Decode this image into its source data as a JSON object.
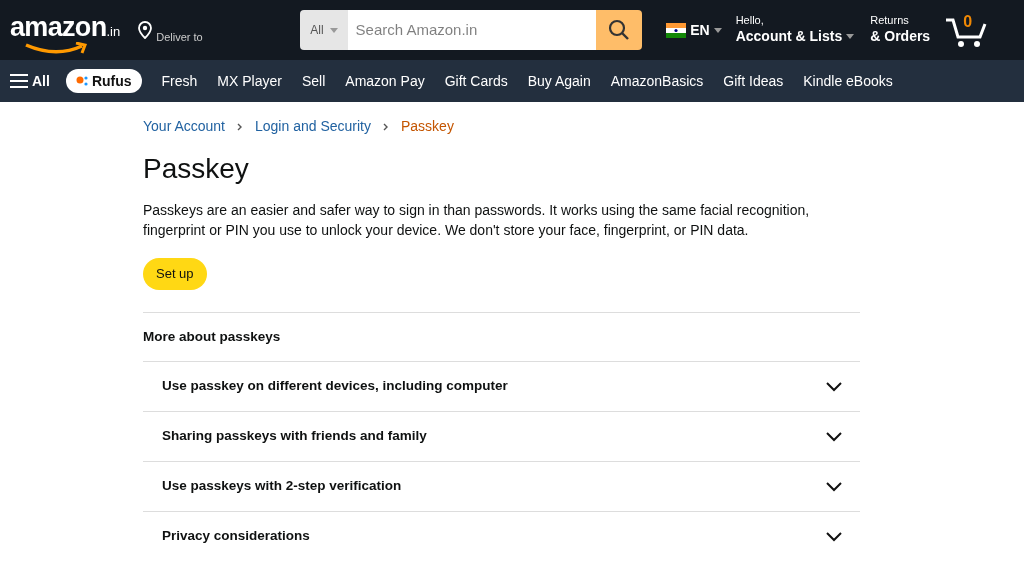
{
  "header": {
    "logo": "amazon",
    "logo_suffix": ".in",
    "deliver_label": "Deliver to",
    "search_category": "All",
    "search_placeholder": "Search Amazon.in",
    "language": "EN",
    "greeting": "Hello,",
    "account": "Account & Lists",
    "returns_top": "Returns",
    "returns_bottom": "& Orders",
    "cart_count": "0"
  },
  "nav": {
    "all": "All",
    "rufus": "Rufus",
    "links": [
      "Fresh",
      "MX Player",
      "Sell",
      "Amazon Pay",
      "Gift Cards",
      "Buy Again",
      "AmazonBasics",
      "Gift Ideas",
      "Kindle eBooks"
    ]
  },
  "breadcrumb": [
    {
      "label": "Your Account",
      "selected": false
    },
    {
      "label": "Login and Security",
      "selected": false
    },
    {
      "label": "Passkey",
      "selected": true
    }
  ],
  "title": "Passkey",
  "description": "Passkeys are an easier and safer way to sign in than passwords. It works using the same facial recognition, fingerprint or PIN you use to unlock your device. We don't store your face, fingerprint, or PIN data.",
  "setup_button": "Set up",
  "more_heading": "More about passkeys",
  "faq": [
    {
      "label": "Use passkey on different devices, including computer",
      "expanded": false
    },
    {
      "label": "Sharing passkeys with friends and family",
      "expanded": false
    },
    {
      "label": "Use passkeys with 2-step verification",
      "expanded": false
    },
    {
      "label": "Privacy considerations",
      "expanded": false
    }
  ]
}
